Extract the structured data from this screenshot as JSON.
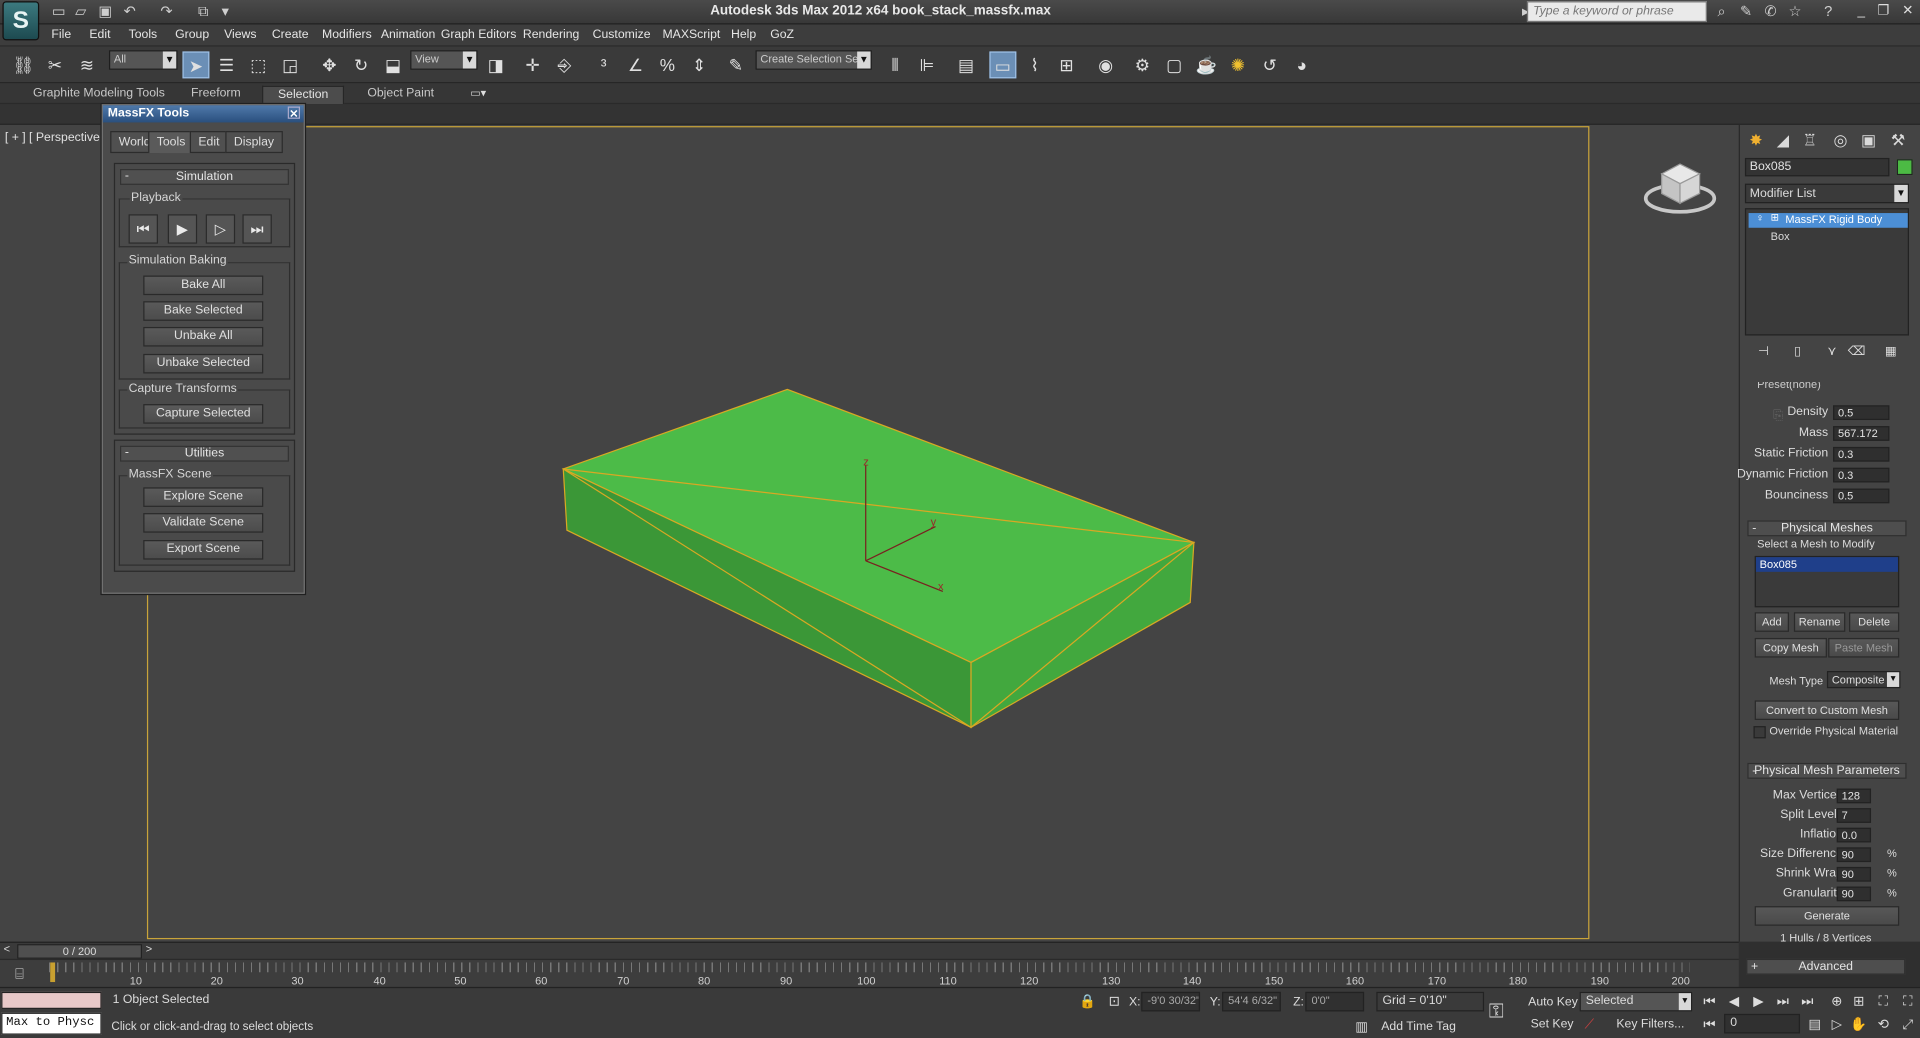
{
  "app": {
    "title": "Autodesk 3ds Max  2012 x64     book_stack_massfx.max",
    "logo": "S",
    "search_placeholder": "Type a keyword or phrase"
  },
  "menu": [
    "File",
    "Edit",
    "Tools",
    "Group",
    "Views",
    "Create",
    "Modifiers",
    "Animation",
    "Graph Editors",
    "Rendering",
    "Customize",
    "MAXScript",
    "Help",
    "GoZ"
  ],
  "toolbar": {
    "filter_value": "All",
    "ref_coord_value": "View",
    "selection_set_value": "Create Selection Se"
  },
  "ribbon_tabs": [
    "Graphite Modeling Tools",
    "Freeform",
    "Selection",
    "Object Paint"
  ],
  "viewport": {
    "label": "[ + ] [ Perspective ]",
    "axis_x": "x",
    "axis_y": "y",
    "axis_z": "z"
  },
  "massfx": {
    "title": "MassFX Tools",
    "tabs": [
      "World",
      "Tools",
      "Edit",
      "Display"
    ],
    "simulation": {
      "header": "Simulation",
      "playback_label": "Playback",
      "baking_label": "Simulation Baking",
      "bake_all": "Bake All",
      "bake_selected": "Bake Selected",
      "unbake_all": "Unbake All",
      "unbake_selected": "Unbake Selected",
      "capture_label": "Capture Transforms",
      "capture_selected": "Capture Selected"
    },
    "utilities": {
      "header": "Utilities",
      "scene_label": "MassFX Scene",
      "explore": "Explore Scene",
      "validate": "Validate Scene",
      "export": "Export Scene"
    }
  },
  "command_panel": {
    "object_name": "Box085",
    "object_color": "#4cba44",
    "modifier_list": "Modifier List",
    "stack_modifier": "MassFX Rigid Body",
    "stack_base": "Box",
    "preset_label": "Preset",
    "preset_value": "(none)",
    "params": [
      {
        "label": "Density",
        "value": "0.5"
      },
      {
        "label": "Mass",
        "value": "567.172"
      },
      {
        "label": "Static Friction",
        "value": "0.3"
      },
      {
        "label": "Dynamic Friction",
        "value": "0.3"
      },
      {
        "label": "Bounciness",
        "value": "0.5"
      }
    ],
    "physical_meshes": {
      "header": "Physical Meshes",
      "select_label": "Select a Mesh to Modify",
      "mesh_item": "Box085",
      "add": "Add",
      "rename": "Rename",
      "delete": "Delete",
      "copy_mesh": "Copy Mesh",
      "paste_mesh": "Paste Mesh",
      "mesh_type_label": "Mesh Type",
      "mesh_type_value": "Composite",
      "convert": "Convert to Custom Mesh",
      "override": "Override Physical Material"
    },
    "mesh_params": {
      "header": "Physical Mesh Parameters",
      "rows": [
        {
          "label": "Max Vertices",
          "value": "128",
          "unit": ""
        },
        {
          "label": "Split Levels",
          "value": "7",
          "unit": ""
        },
        {
          "label": "Inflation",
          "value": "0.0",
          "unit": ""
        },
        {
          "label": "Size Difference",
          "value": "90",
          "unit": "%"
        },
        {
          "label": "Shrink Wrap",
          "value": "90",
          "unit": "%"
        },
        {
          "label": "Granularity",
          "value": "90",
          "unit": "%"
        }
      ],
      "generate": "Generate",
      "result": "1 Hulls / 8 Vertices",
      "advanced": "Advanced"
    }
  },
  "timeline": {
    "frame_display": "0 / 200",
    "ticks": [
      "10",
      "20",
      "30",
      "40",
      "50",
      "60",
      "70",
      "80",
      "90",
      "100",
      "110",
      "120",
      "130",
      "140",
      "150",
      "160",
      "170",
      "180",
      "190",
      "200"
    ]
  },
  "status": {
    "listener": "Max to Physc",
    "selection": "1 Object Selected",
    "prompt": "Click or click-and-drag to select objects",
    "x_label": "X:",
    "x_value": "-9'0 30/32\"",
    "y_label": "Y:",
    "y_value": "54'4 6/32\"",
    "z_label": "Z:",
    "z_value": "0'0\"",
    "grid": "Grid = 0'10\"",
    "add_time_tag": "Add Time Tag",
    "auto_key": "Auto Key",
    "set_key": "Set Key",
    "selected_value": "Selected",
    "key_filters": "Key Filters...",
    "frame_field": "0"
  }
}
